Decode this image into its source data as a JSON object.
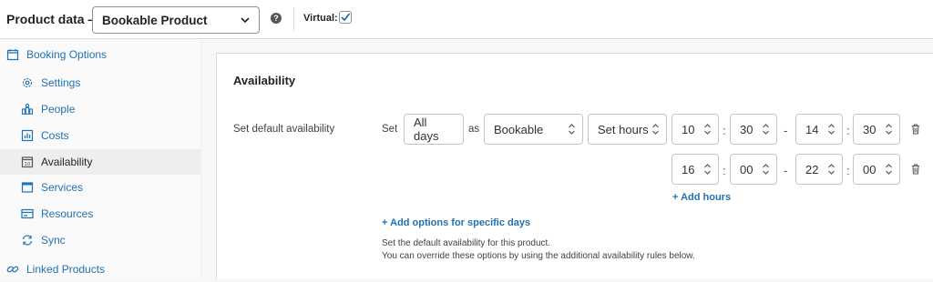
{
  "header": {
    "title": "Product data —",
    "product_type": "Bookable Product",
    "help_glyph": "?",
    "virtual_label": "Virtual:",
    "virtual_checked": true
  },
  "sidebar": {
    "section": "Booking Options",
    "items": [
      {
        "label": "Settings",
        "icon": "gear-icon"
      },
      {
        "label": "People",
        "icon": "people-icon"
      },
      {
        "label": "Costs",
        "icon": "chart-icon"
      },
      {
        "label": "Availability",
        "icon": "calendar-icon",
        "active": true
      },
      {
        "label": "Services",
        "icon": "window-icon"
      },
      {
        "label": "Resources",
        "icon": "card-icon"
      },
      {
        "label": "Sync",
        "icon": "sync-icon"
      }
    ],
    "linked": "Linked Products"
  },
  "main": {
    "heading": "Availability",
    "row_label": "Set default availability",
    "set_label": "Set",
    "days_value": "All days",
    "as_label": "as",
    "bookable_value": "Bookable",
    "hours_value": "Set hours",
    "ranges": [
      {
        "from_h": "10",
        "from_m": "30",
        "to_h": "14",
        "to_m": "30"
      },
      {
        "from_h": "16",
        "from_m": "00",
        "to_h": "22",
        "to_m": "00"
      }
    ],
    "colon": ":",
    "dash": "-",
    "add_hours": "+ Add hours",
    "add_specific_days": "+ Add options for specific days",
    "note_line1": "Set the default availability for this product.",
    "note_line2": "You can override these options by using the additional availability rules below."
  },
  "colors": {
    "link": "#2271b1",
    "accent": "#3582c4"
  }
}
